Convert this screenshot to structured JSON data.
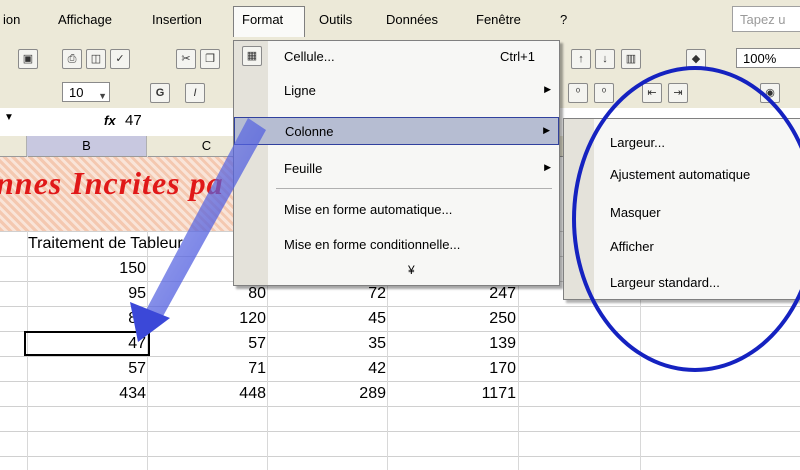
{
  "menubar": {
    "items": [
      "ion",
      "Affichage",
      "Insertion",
      "Format",
      "Outils",
      "Données",
      "Fenêtre",
      "?"
    ],
    "help_placeholder": "Tapez u"
  },
  "toolbar": {
    "font_size": "10",
    "zoom": "100%"
  },
  "formula_bar": {
    "fx": "fx",
    "value": "47"
  },
  "sheet": {
    "col_b": "B",
    "col_c": "C",
    "banner_text": "nnes Incrites pa",
    "header_cell": "Traitement de Tableur",
    "col_b_values": [
      "150",
      "95",
      "85",
      "47",
      "57",
      "434"
    ],
    "col_c_values": [
      "80",
      "120",
      "57",
      "71",
      "448"
    ],
    "col_d_values": [
      "72",
      "45",
      "35",
      "42",
      "289"
    ],
    "col_e_values": [
      "247",
      "250",
      "139",
      "170",
      "1171"
    ]
  },
  "format_menu": {
    "items": [
      {
        "label": "Cellule...",
        "shortcut": "Ctrl+1",
        "submenu": false
      },
      {
        "label": "Ligne",
        "shortcut": "",
        "submenu": true
      },
      {
        "label": "Colonne",
        "shortcut": "",
        "submenu": true
      },
      {
        "label": "Feuille",
        "shortcut": "",
        "submenu": true
      },
      {
        "label": "Mise en forme automatique...",
        "shortcut": "",
        "submenu": false
      },
      {
        "label": "Mise en forme conditionnelle...",
        "shortcut": "",
        "submenu": false
      }
    ],
    "more": "¥"
  },
  "column_submenu": {
    "items": [
      "Largeur...",
      "Ajustement automatique",
      "Masquer",
      "Afficher",
      "Largeur standard..."
    ]
  },
  "colors": {
    "highlight": "#b6bdd2",
    "annotation_blue": "#1522c0",
    "banner_red": "#e01818"
  }
}
